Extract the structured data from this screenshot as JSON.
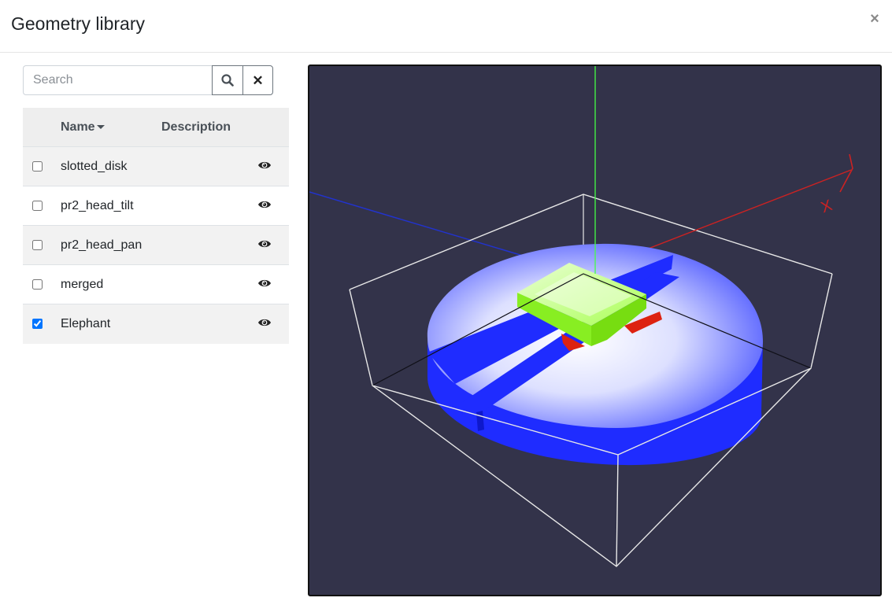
{
  "modal": {
    "title": "Geometry library",
    "close_glyph": "×"
  },
  "search": {
    "placeholder": "Search",
    "value": "",
    "search_icon": "search-icon",
    "clear_glyph": "✕"
  },
  "table": {
    "columns": {
      "name": "Name",
      "description": "Description"
    },
    "sort": {
      "column": "name",
      "direction": "descending-caret"
    },
    "rows": [
      {
        "name": "slotted_disk",
        "description": "",
        "checked": false,
        "icon": "eye-icon"
      },
      {
        "name": "pr2_head_tilt",
        "description": "",
        "checked": false,
        "icon": "eye-icon"
      },
      {
        "name": "pr2_head_pan",
        "description": "",
        "checked": false,
        "icon": "eye-icon"
      },
      {
        "name": "merged",
        "description": "",
        "checked": false,
        "icon": "eye-icon"
      },
      {
        "name": "Elephant",
        "description": "",
        "checked": true,
        "icon": "eye-icon"
      }
    ]
  },
  "viewer": {
    "background_color": "#33334a",
    "axis_x_color": "#cc2222",
    "axis_y_color": "#44ff44",
    "axis_z_color": "#2233cc",
    "disk_color": "#1f2cff",
    "box_color": "#99ff33",
    "bounding_box_color": "#ffffff"
  }
}
